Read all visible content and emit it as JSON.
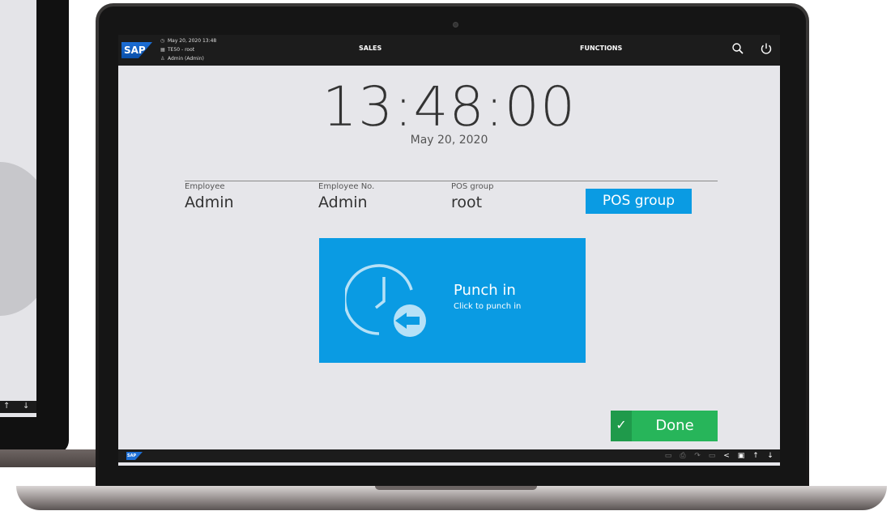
{
  "header": {
    "datetime": "May 20, 2020 13:48",
    "terminal": "TE50 - root",
    "user": "Admin (Admin)",
    "menu_sales": "SALES",
    "menu_functions": "FUNCTIONS",
    "logo": "SAP"
  },
  "clock": {
    "time": "13:48:00",
    "date": "May 20, 2020"
  },
  "employee": {
    "employee_label": "Employee",
    "employee_value": "Admin",
    "number_label": "Employee No.",
    "number_value": "Admin",
    "pos_group_label": "POS group",
    "pos_group_value": "root",
    "pos_group_button": "POS group"
  },
  "punch": {
    "title": "Punch in",
    "subtitle": "Click to punch in",
    "icon": "clock-punch-in-icon"
  },
  "done_label": "Done",
  "footer_logo": "SAP",
  "background_taskbar_icons": [
    "↑",
    "↓"
  ],
  "colors": {
    "accent_blue": "#0a9be3",
    "done_green": "#27b55a",
    "bar_dark": "#1c1c1c",
    "screen_bg": "#e6e6ea"
  }
}
